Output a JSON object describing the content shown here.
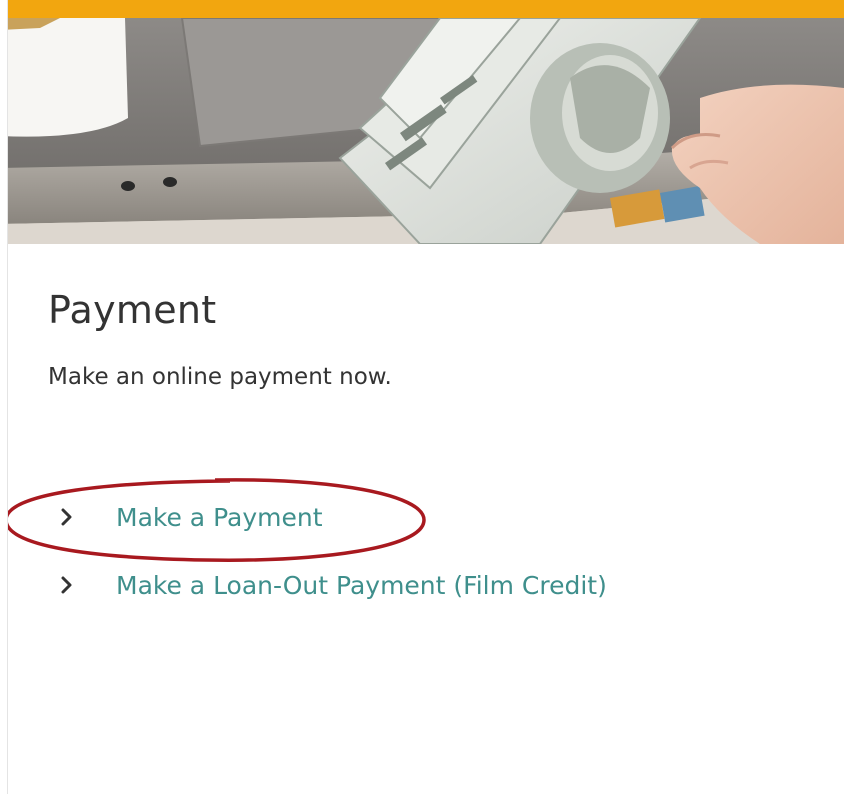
{
  "header": {
    "accent_color": "#f2a60f",
    "hero_image": "hand holding hundred-dollar bills over laptop"
  },
  "card": {
    "title": "Payment",
    "description": "Make an online payment now."
  },
  "links": [
    {
      "label": "Make a Payment",
      "icon": "chevron-right-icon"
    },
    {
      "label": "Make a Loan-Out Payment (Film Credit)",
      "icon": "chevron-right-icon"
    }
  ],
  "annotation": {
    "highlight_color": "#a8191f",
    "highlighted_link": "Make a Payment"
  },
  "colors": {
    "link": "#3f8f8c",
    "text": "#333333"
  }
}
